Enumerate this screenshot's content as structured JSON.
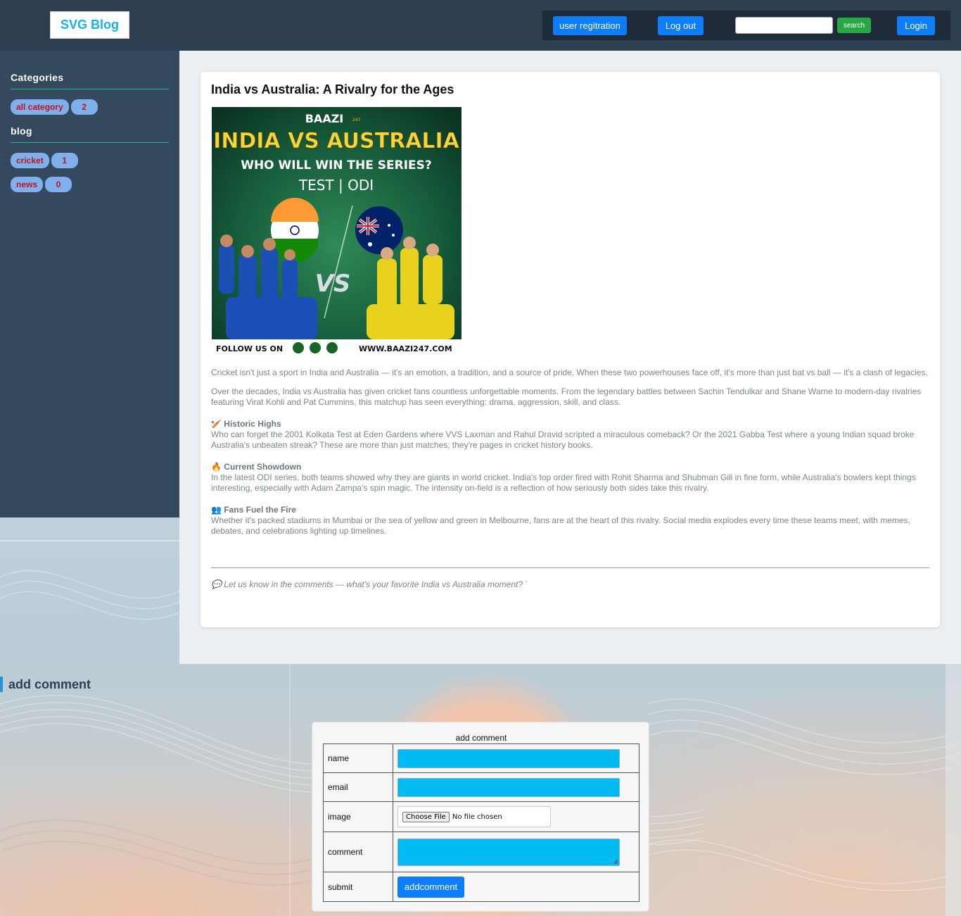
{
  "header": {
    "logo": "SVG Blog",
    "nav": {
      "register": "user regitration",
      "logout": "Log out",
      "search_placeholder": "",
      "search_button": "search",
      "login": "Login"
    }
  },
  "sidebar": {
    "categories_heading": "Categories",
    "all_category": {
      "label": "all category",
      "count": "2"
    },
    "blog_heading": "blog",
    "items": [
      {
        "label": "cricket",
        "count": "1"
      },
      {
        "label": "news",
        "count": "0"
      }
    ]
  },
  "post": {
    "title": "India vs Australia: A Rivalry for the Ages",
    "image": {
      "brand": "BAAZI",
      "brand_suffix": "247",
      "headline": "INDIA VS AUSTRALIA",
      "subhead": "WHO WILL WIN THE SERIES?",
      "formats": "TEST | ODI",
      "vs": "VS",
      "follow": "FOLLOW US ON",
      "website": "WWW.BAAZI247.COM"
    },
    "paragraphs": [
      "Cricket isn't just a sport in India and Australia — it's an emotion, a tradition, and a source of pride. When these two powerhouses face off, it's more than just bat vs ball — it's a clash of legacies.",
      "Over the decades, India vs Australia has given cricket fans countless unforgettable moments. From the legendary battles between Sachin Tendulkar and Shane Warne to modern-day rivalries featuring Virat Kohli and Pat Cummins, this matchup has seen everything: drama, aggression, skill, and class."
    ],
    "sections": [
      {
        "icon": "🏏",
        "heading": "Historic Highs",
        "text": "Who can forget the 2001 Kolkata Test at Eden Gardens where VVS Laxman and Rahul Dravid scripted a miraculous comeback? Or the 2021 Gabba Test where a young Indian squad broke Australia's unbeaten streak? These are more than just matches; they're pages in cricket history books."
      },
      {
        "icon": "🔥",
        "heading": "Current Showdown",
        "text": "In the latest ODI series, both teams showed why they are giants in world cricket. India's top order fired with Rohit Sharma and Shubman Gill in fine form, while Australia's bowlers kept things interesting, especially with Adam Zampa's spin magic. The intensity on-field is a reflection of how seriously both sides take this rivalry."
      },
      {
        "icon": "👥",
        "heading": "Fans Fuel the Fire",
        "text": "Whether it's packed stadiums in Mumbai or the sea of yellow and green in Melbourne, fans are at the heart of this rivalry. Social media explodes every time these teams meet, with memes, debates, and celebrations lighting up timelines."
      }
    ],
    "closing_icon": "💬",
    "closing": "Let us know in the comments — what's your favorite India vs Australia moment? `"
  },
  "comments": {
    "section_heading": "add comment",
    "form_caption": "add comment",
    "fields": {
      "name": "name",
      "email": "email",
      "image": "image",
      "comment": "comment",
      "submit": "submit"
    },
    "file_button": "Choose File",
    "file_status": "No file chosen",
    "submit_button": "addcomment"
  },
  "colors": {
    "header_bg": "#2d3e50",
    "sidebar_bg": "#34495e",
    "primary_button": "#0d7dfb",
    "search_button": "#28a745",
    "input_fill": "#00bbf0",
    "pill_bg": "#7fb0ec",
    "pill_text": "#c0121c"
  }
}
